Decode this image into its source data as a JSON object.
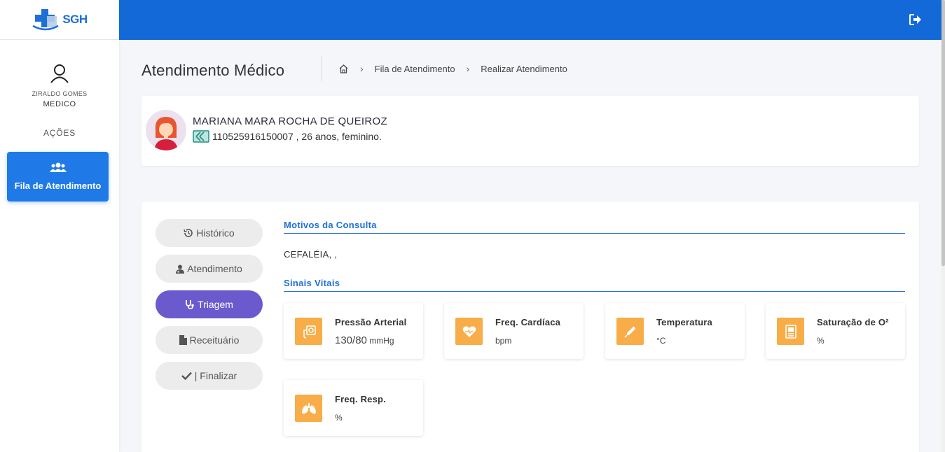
{
  "brand": {
    "logo_text": "SGH",
    "accent": "#1469d9",
    "active_nav": "#1f7ae8",
    "triage_active": "#6a5acd",
    "vital_icon_bg": "#f8ad48"
  },
  "sidebar": {
    "user_name": "ZIRALDO GOMES",
    "user_role": "MEDICO",
    "section_label": "AÇÕES",
    "items": [
      {
        "label": "Fila de Atendimento",
        "icon": "users-icon"
      }
    ]
  },
  "topbar": {
    "logout_icon": "sign-out-icon"
  },
  "header": {
    "title": "Atendimento Médico",
    "breadcrumb": [
      "Fila de Atendimento",
      "Realizar Atendimento"
    ]
  },
  "patient": {
    "name": "MARIANA MARA ROCHA DE QUEIROZ",
    "info": "110525916150007 , 26 anos, feminino."
  },
  "menu": [
    {
      "label": "Histórico",
      "icon": "history-icon"
    },
    {
      "label": "Atendimento",
      "icon": "user-doctor-icon"
    },
    {
      "label": "Triagem",
      "icon": "stethoscope-icon"
    },
    {
      "label": "Receituário",
      "icon": "file-icon"
    },
    {
      "label": "| Finalizar",
      "icon": "check-icon"
    }
  ],
  "sections": {
    "motivos_title": "Motivos da Consulta",
    "motivos_text": "CEFALÉIA, ,",
    "sinais_title": "Sinais Vitais"
  },
  "vitals": [
    {
      "label": "Pressão Arterial",
      "value": "130/80",
      "unit": "mmHg",
      "icon": "blood-pressure-icon"
    },
    {
      "label": "Freq. Cardíaca",
      "value": "",
      "unit": "bpm",
      "icon": "heart-icon"
    },
    {
      "label": "Temperatura",
      "value": "",
      "unit": "°C",
      "icon": "thermometer-icon"
    },
    {
      "label": "Saturação de O²",
      "value": "",
      "unit": "%",
      "icon": "oximeter-icon"
    },
    {
      "label": "Freq. Resp.",
      "value": "",
      "unit": "%",
      "icon": "lungs-icon"
    }
  ]
}
